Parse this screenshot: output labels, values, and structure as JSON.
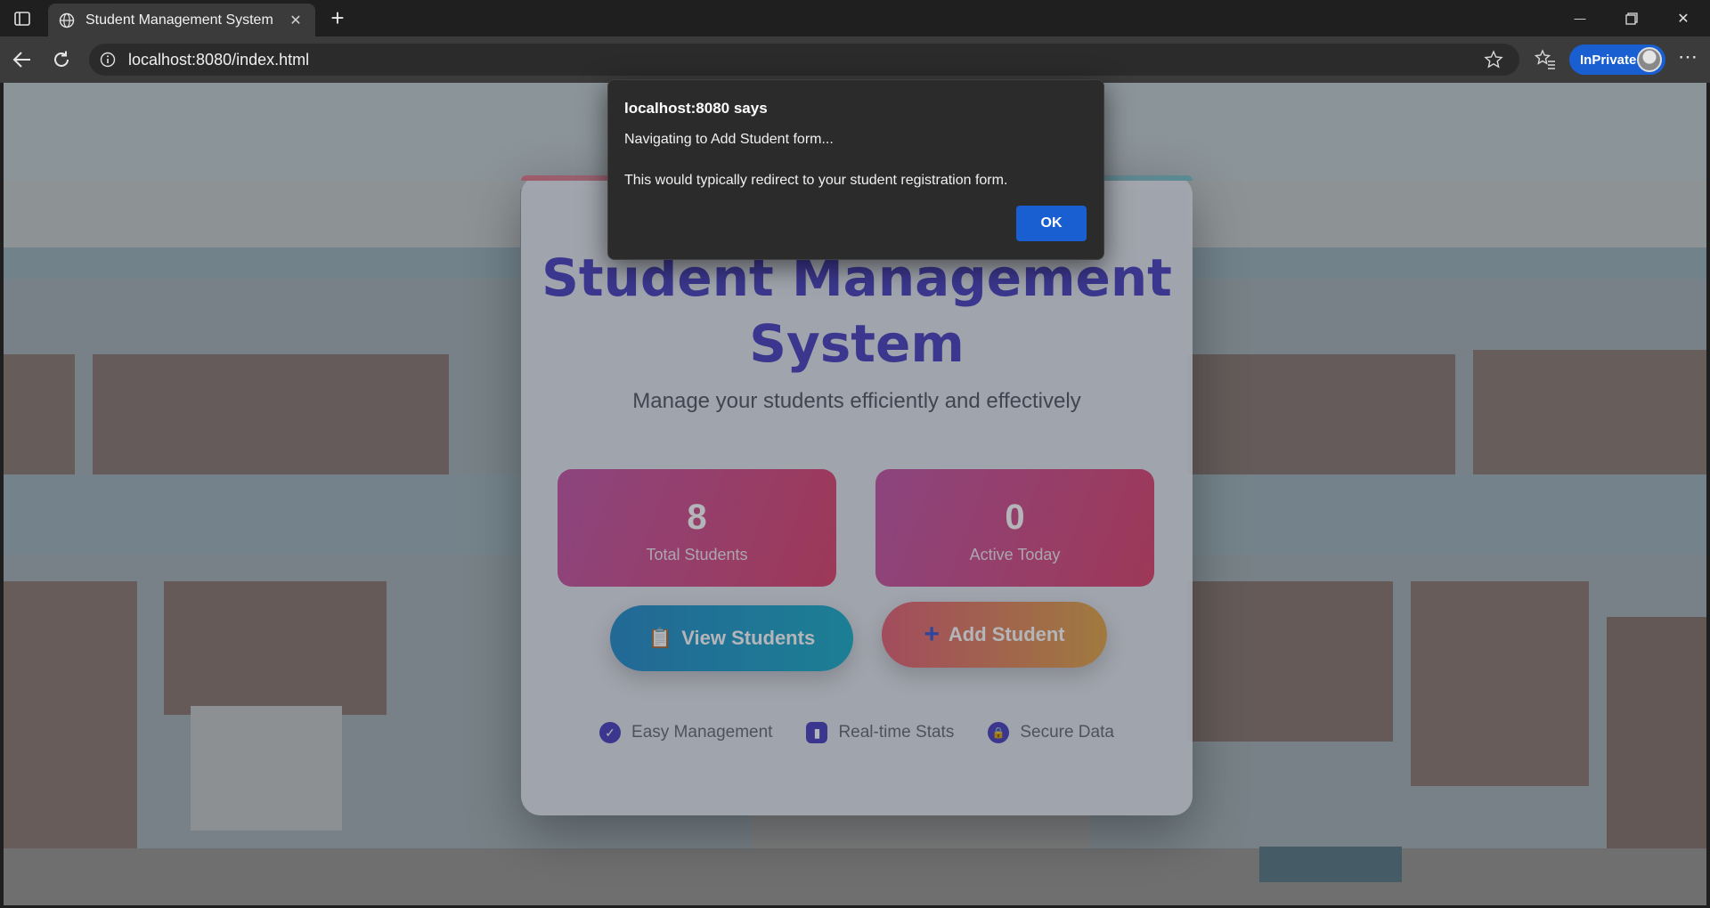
{
  "browser": {
    "tab_title": "Student Management System",
    "tab_close": "✕",
    "new_tab": "+",
    "url": "localhost:8080/index.html",
    "inprivate_label": "InPrivate",
    "more": "⋯",
    "minimize": "—",
    "close": "✕"
  },
  "card": {
    "title": "Student Management System",
    "subtitle": "Manage your students efficiently and effectively",
    "stats": [
      {
        "value": "8",
        "label": "Total Students"
      },
      {
        "value": "0",
        "label": "Active Today"
      }
    ],
    "buttons": {
      "view_icon": "📋",
      "view_label": "View Students",
      "add_icon": "+",
      "add_label": "Add Student"
    },
    "features": [
      {
        "icon": "✓",
        "label": "Easy Management"
      },
      {
        "icon": "▮",
        "label": "Real-time Stats"
      },
      {
        "icon": "🔒",
        "label": "Secure Data"
      }
    ]
  },
  "dialog": {
    "title": "localhost:8080 says",
    "message_line1": "Navigating to Add Student form...",
    "message_line2": "This would typically redirect to your student registration form.",
    "ok_label": "OK"
  },
  "colors": {
    "accent": "#1a5fd1",
    "title_purple": "#4f46c0",
    "stat_gradient_start": "#c65aa8",
    "stat_gradient_end": "#e04870"
  }
}
